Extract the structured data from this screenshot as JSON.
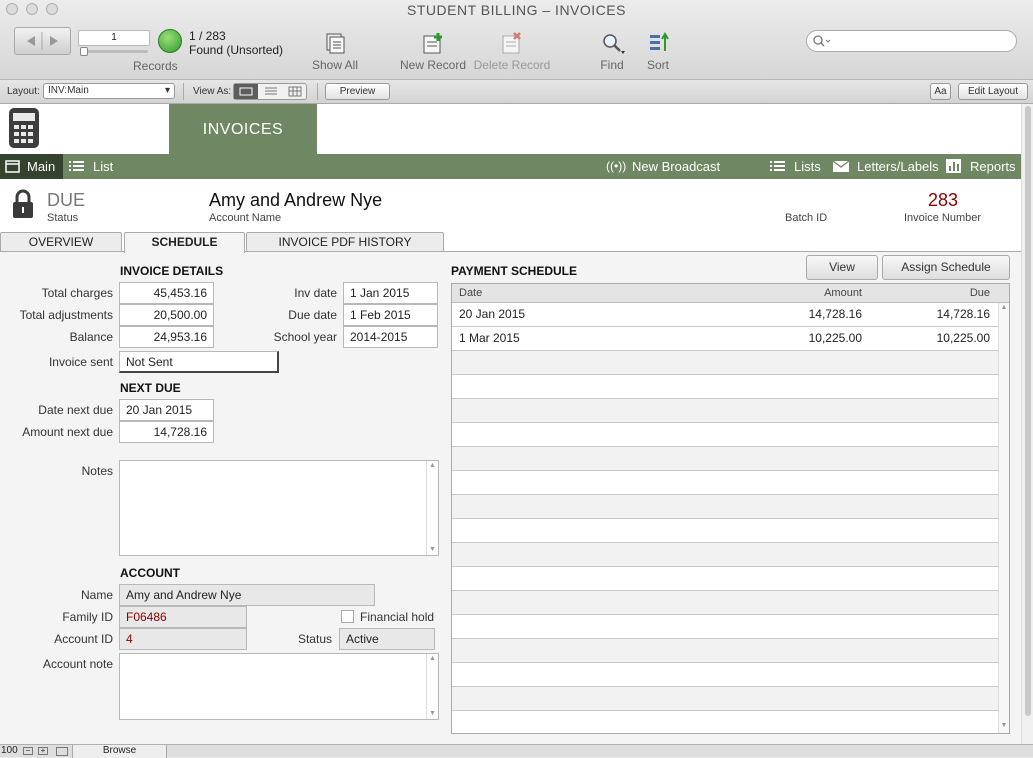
{
  "window": {
    "title": "STUDENT BILLING – INVOICES"
  },
  "toolbar": {
    "record_input": "1",
    "record_count": "1 / 283",
    "found_status": "Found (Unsorted)",
    "records_label": "Records",
    "show_all": "Show All",
    "new_record": "New Record",
    "delete_record": "Delete Record",
    "find": "Find",
    "sort": "Sort"
  },
  "layoutbar": {
    "layout_label": "Layout:",
    "layout_value": "INV:Main",
    "view_as_label": "View As:",
    "preview": "Preview",
    "aa": "Aa",
    "edit_layout": "Edit Layout"
  },
  "header": {
    "title": "INVOICES",
    "nav_main": "Main",
    "nav_list": "List",
    "new_broadcast": "New Broadcast",
    "lists": "Lists",
    "letters_labels": "Letters/Labels",
    "reports": "Reports"
  },
  "record": {
    "status_value": "DUE",
    "status_label": "Status",
    "account_name": "Amy and Andrew Nye",
    "account_name_label": "Account Name",
    "batch_id_label": "Batch ID",
    "invoice_number": "283",
    "invoice_number_label": "Invoice Number"
  },
  "tabs": [
    {
      "label": "OVERVIEW"
    },
    {
      "label": "SCHEDULE"
    },
    {
      "label": "INVOICE PDF HISTORY"
    }
  ],
  "invoice_details": {
    "heading": "INVOICE DETAILS",
    "total_charges_label": "Total charges",
    "total_charges": "45,453.16",
    "total_adjustments_label": "Total adjustments",
    "total_adjustments": "20,500.00",
    "balance_label": "Balance",
    "balance": "24,953.16",
    "inv_date_label": "Inv date",
    "inv_date": "1 Jan 2015",
    "due_date_label": "Due date",
    "due_date": "1 Feb 2015",
    "school_year_label": "School year",
    "school_year": "2014-2015",
    "invoice_sent_label": "Invoice sent",
    "invoice_sent": "Not Sent"
  },
  "next_due": {
    "heading": "NEXT DUE",
    "date_label": "Date next due",
    "date": "20 Jan 2015",
    "amount_label": "Amount next due",
    "amount": "14,728.16"
  },
  "notes": {
    "label": "Notes"
  },
  "account": {
    "heading": "ACCOUNT",
    "name_label": "Name",
    "name": "Amy and Andrew Nye",
    "family_id_label": "Family ID",
    "family_id": "F06486",
    "financial_hold_label": "Financial hold",
    "account_id_label": "Account ID",
    "account_id": "4",
    "status_label": "Status",
    "status": "Active",
    "account_note_label": "Account note"
  },
  "payment_schedule": {
    "heading": "PAYMENT SCHEDULE",
    "view_button": "View",
    "assign_button": "Assign Schedule",
    "columns": {
      "date": "Date",
      "amount": "Amount",
      "due": "Due"
    },
    "rows": [
      {
        "date": "20 Jan 2015",
        "amount": "14,728.16",
        "due": "14,728.16"
      },
      {
        "date": "1 Mar 2015",
        "amount": "10,225.00",
        "due": "10,225.00"
      }
    ]
  },
  "statusbar": {
    "zoom": "100",
    "mode": "Browse"
  },
  "colors": {
    "header_green": "#6f8762",
    "nav_active": "#35432e",
    "invoice_number": "#8b0000"
  }
}
